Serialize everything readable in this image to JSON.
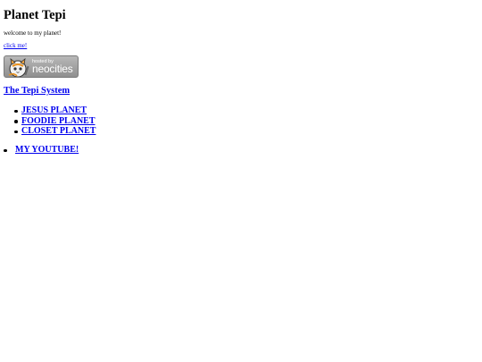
{
  "header": {
    "title": "Planet Tepi",
    "welcome": "welcome to my planet!",
    "click_link": "click me!"
  },
  "badge": {
    "hosted_label": "hosted by",
    "brand": "neocities",
    "icon": "neocities-cat-icon"
  },
  "system": {
    "link": "The Tepi System"
  },
  "planets": [
    {
      "label": "JESUS PLANET"
    },
    {
      "label": "FOODIE PLANET"
    },
    {
      "label": "CLOSET PLANET"
    }
  ],
  "youtube": {
    "label": "MY YOUTUBE!"
  },
  "colors": {
    "link": "#0000ee",
    "text": "#000000",
    "background": "#ffffff"
  }
}
